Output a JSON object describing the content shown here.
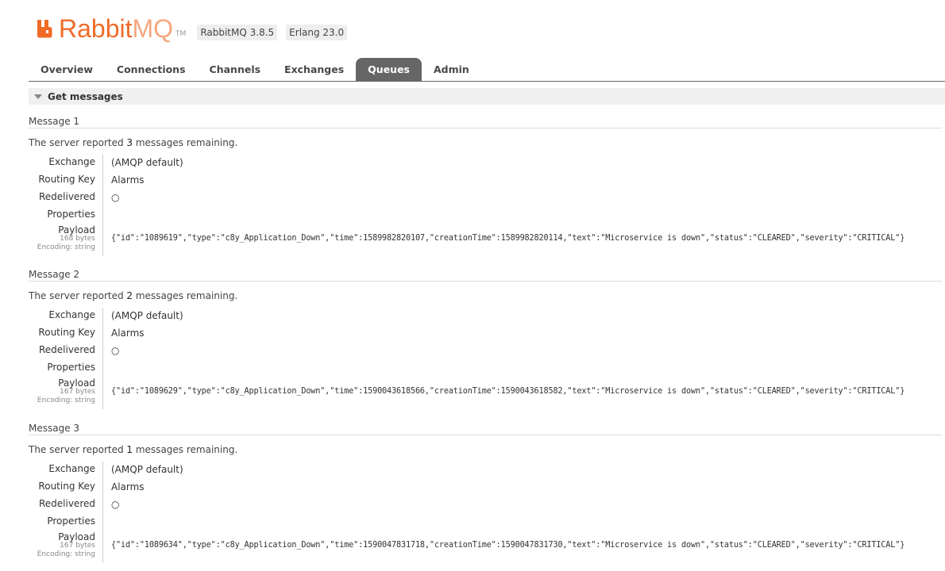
{
  "header": {
    "logo_rabbit": "Rabbit",
    "logo_mq": "MQ",
    "logo_tm": "TM",
    "version_rabbit": "RabbitMQ 3.8.5",
    "version_erlang": "Erlang 23.0",
    "brand_color": "#f06b27"
  },
  "tabs": [
    {
      "label": "Overview"
    },
    {
      "label": "Connections"
    },
    {
      "label": "Channels"
    },
    {
      "label": "Exchanges"
    },
    {
      "label": "Queues",
      "active": true
    },
    {
      "label": "Admin"
    }
  ],
  "section": {
    "title": "Get messages",
    "icon": "collapse-triangle-icon"
  },
  "labels": {
    "exchange": "Exchange",
    "routing_key": "Routing Key",
    "redelivered": "Redelivered",
    "properties": "Properties",
    "payload": "Payload",
    "encoding": "Encoding: string"
  },
  "messages": [
    {
      "title": "Message 1",
      "remaining_prefix": "The server reported ",
      "remaining_count": "3",
      "remaining_suffix": " messages remaining.",
      "exchange": "(AMQP default)",
      "routing_key": "Alarms",
      "redelivered": "○",
      "properties": "",
      "payload_bytes": "168 bytes",
      "payload": "{\"id\":\"1089619\",\"type\":\"c8y_Application_Down\",\"time\":1589982820107,\"creationTime\":1589982820114,\"text\":\"Microservice is down\",\"status\":\"CLEARED\",\"severity\":\"CRITICAL\"}"
    },
    {
      "title": "Message 2",
      "remaining_prefix": "The server reported ",
      "remaining_count": "2",
      "remaining_suffix": " messages remaining.",
      "exchange": "(AMQP default)",
      "routing_key": "Alarms",
      "redelivered": "○",
      "properties": "",
      "payload_bytes": "167 bytes",
      "payload": "{\"id\":\"1089629\",\"type\":\"c8y_Application_Down\",\"time\":1590043618566,\"creationTime\":1590043618582,\"text\":\"Microservice is down\",\"status\":\"CLEARED\",\"severity\":\"CRITICAL\"}"
    },
    {
      "title": "Message 3",
      "remaining_prefix": "The server reported ",
      "remaining_count": "1",
      "remaining_suffix": " messages remaining.",
      "exchange": "(AMQP default)",
      "routing_key": "Alarms",
      "redelivered": "○",
      "properties": "",
      "payload_bytes": "167 bytes",
      "payload": "{\"id\":\"1089634\",\"type\":\"c8y_Application_Down\",\"time\":1590047831718,\"creationTime\":1590047831730,\"text\":\"Microservice is down\",\"status\":\"CLEARED\",\"severity\":\"CRITICAL\"}"
    }
  ]
}
